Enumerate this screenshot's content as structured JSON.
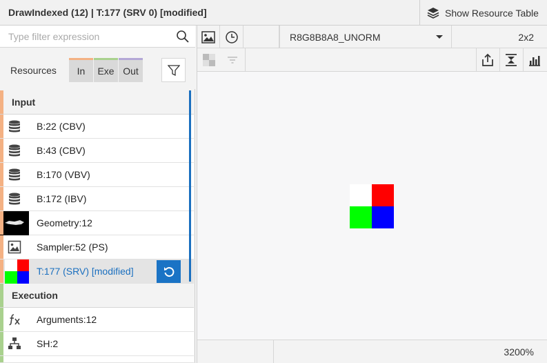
{
  "window": {
    "title": "DrawIndexed (12) | T:177 (SRV 0) [modified]",
    "show_resource_table": "Show Resource Table"
  },
  "filter": {
    "placeholder": "Type filter expression",
    "value": ""
  },
  "resources": {
    "label": "Resources",
    "tabs": [
      {
        "label": "In",
        "color": "#f4b183"
      },
      {
        "label": "Exe",
        "color": "#a9d18e"
      },
      {
        "label": "Out",
        "color": "#b4a7d6"
      }
    ]
  },
  "groups": {
    "input": {
      "label": "Input",
      "stripe_color": "#f4b183",
      "items": [
        {
          "label": "B:22 (CBV)",
          "icon": "database-icon"
        },
        {
          "label": "B:43 (CBV)",
          "icon": "database-icon"
        },
        {
          "label": "B:170 (VBV)",
          "icon": "database-icon"
        },
        {
          "label": "B:172 (IBV)",
          "icon": "database-icon"
        },
        {
          "label": "Geometry:12",
          "icon": "geometry-thumbnail"
        },
        {
          "label": "Sampler:52 (PS)",
          "icon": "sampler-icon"
        },
        {
          "label": "T:177 (SRV) [modified]",
          "icon": "texture-thumbnail",
          "selected": true
        }
      ]
    },
    "execution": {
      "label": "Execution",
      "stripe_color": "#a9d18e",
      "items": [
        {
          "label": "Arguments:12",
          "icon": "function-icon"
        },
        {
          "label": "SH:2",
          "icon": "hierarchy-icon"
        }
      ]
    }
  },
  "viewer": {
    "format": "R8G8B8A8_UNORM",
    "size": "2x2",
    "zoom": "3200%",
    "texture_pixels": [
      "#ffffff",
      "#ff0000",
      "#00ff00",
      "#0000ff"
    ]
  },
  "colors": {
    "accent": "#1a73c5",
    "selected_text": "#1a6fbf"
  }
}
